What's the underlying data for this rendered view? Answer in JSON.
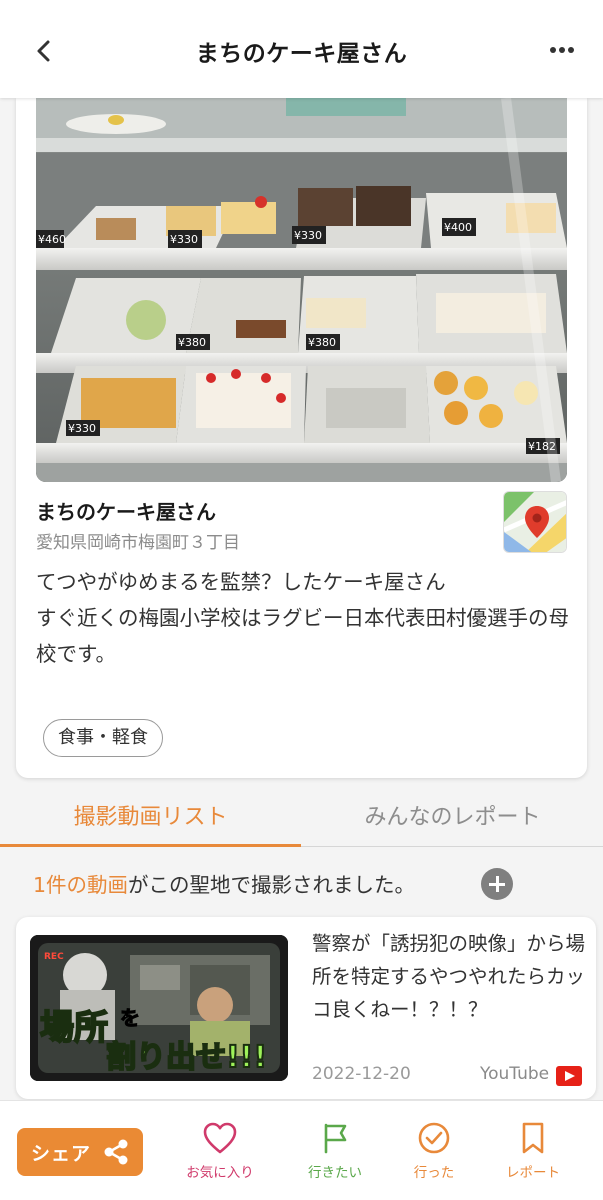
{
  "header": {
    "title": "まちのケーキ屋さん"
  },
  "spot": {
    "name": "まちのケーキ屋さん",
    "address": "愛知県岡崎市梅園町３丁目",
    "description": "てつやがゆめまるを監禁？したケーキ屋さん\nすぐ近くの梅園小学校はラグビー日本代表田村優選手の母校です。",
    "tag": "食事・軽食",
    "price_tags": [
      "¥460",
      "¥330",
      "¥330",
      "¥400",
      "¥380",
      "¥380",
      "¥330",
      "¥182"
    ]
  },
  "tabs": {
    "videos": "撮影動画リスト",
    "reports": "みんなのレポート"
  },
  "video_count": {
    "accent": "1件の動画",
    "rest": "がこの聖地で撮影されました。"
  },
  "video": {
    "title": "警察が「誘拐犯の映像」から場所を特定するやつやれたらカッコ良くねー！？！？",
    "date": "2022-12-20",
    "source": "YouTube",
    "thumb_text_1": "場所",
    "thumb_text_2": "を",
    "thumb_text_3": "割り出せ!!!",
    "thumb_rec": "REC"
  },
  "bottom_bar": {
    "share": "シェア",
    "favorite": "お気に入り",
    "want_to_go": "行きたい",
    "went": "行った",
    "report": "レポート"
  },
  "colors": {
    "accent": "#e8893a",
    "favorite": "#d03a6b",
    "want_to_go": "#5aa84a",
    "youtube": "#e62117"
  }
}
